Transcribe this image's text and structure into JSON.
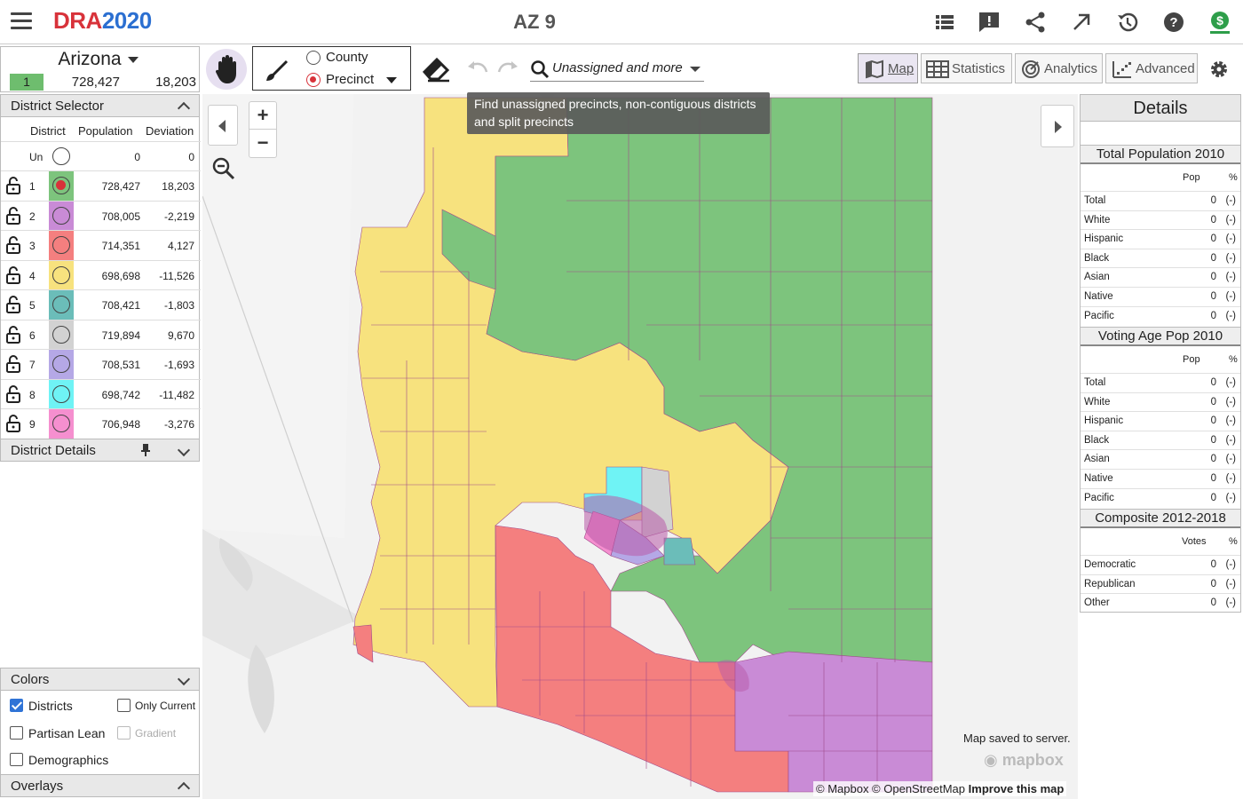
{
  "app": {
    "logo_part1": "DRA",
    "logo_part2": "2020",
    "title": "AZ 9"
  },
  "top_icons": [
    "list-icon",
    "feedback-icon",
    "share-icon",
    "open-external-icon",
    "history-icon",
    "help-icon",
    "donate-icon"
  ],
  "state": {
    "name": "Arizona",
    "badge": "1",
    "population": "728,427",
    "deviation": "18,203"
  },
  "paint": {
    "county_label": "County",
    "precinct_label": "Precinct"
  },
  "search": {
    "label": "Unassigned and more",
    "tooltip": "Find unassigned precincts, non-contiguous districts and split precincts"
  },
  "view_tabs": {
    "map": "Map",
    "statistics": "Statistics",
    "analytics": "Analytics",
    "advanced": "Advanced"
  },
  "district_selector": {
    "title": "District Selector",
    "headers": {
      "district": "District",
      "population": "Population",
      "deviation": "Deviation"
    },
    "unassigned": {
      "num": "Un",
      "population": "0",
      "deviation": "0"
    },
    "rows": [
      {
        "num": "1",
        "population": "728,427",
        "deviation": "18,203",
        "color": "#7dc47d"
      },
      {
        "num": "2",
        "population": "708,005",
        "deviation": "-2,219",
        "color": "#c98bd6"
      },
      {
        "num": "3",
        "population": "714,351",
        "deviation": "4,127",
        "color": "#f47f7f"
      },
      {
        "num": "4",
        "population": "698,698",
        "deviation": "-11,526",
        "color": "#f7e27e"
      },
      {
        "num": "5",
        "population": "708,421",
        "deviation": "-1,803",
        "color": "#6bbdb9"
      },
      {
        "num": "6",
        "population": "719,894",
        "deviation": "9,670",
        "color": "#d2d2d2"
      },
      {
        "num": "7",
        "population": "708,531",
        "deviation": "-1,693",
        "color": "#b5a8e6"
      },
      {
        "num": "8",
        "population": "698,742",
        "deviation": "-11,482",
        "color": "#6ff3f5"
      },
      {
        "num": "9",
        "population": "706,948",
        "deviation": "-3,276",
        "color": "#f58fcf"
      }
    ]
  },
  "district_details": {
    "title": "District Details"
  },
  "colors_panel": {
    "title": "Colors",
    "districts": "Districts",
    "only_current": "Only Current",
    "partisan_lean": "Partisan Lean",
    "gradient": "Gradient",
    "demographics": "Demographics"
  },
  "overlays": {
    "title": "Overlays"
  },
  "details": {
    "title": "Details",
    "total_pop": {
      "title": "Total Population 2010",
      "col_pop": "Pop",
      "col_pct": "%",
      "rows": [
        {
          "name": "Total",
          "value": "0",
          "pct": "(-)"
        },
        {
          "name": "White",
          "value": "0",
          "pct": "(-)"
        },
        {
          "name": "Hispanic",
          "value": "0",
          "pct": "(-)"
        },
        {
          "name": "Black",
          "value": "0",
          "pct": "(-)"
        },
        {
          "name": "Asian",
          "value": "0",
          "pct": "(-)"
        },
        {
          "name": "Native",
          "value": "0",
          "pct": "(-)"
        },
        {
          "name": "Pacific",
          "value": "0",
          "pct": "(-)"
        }
      ]
    },
    "vap": {
      "title": "Voting Age Pop 2010",
      "col_pop": "Pop",
      "col_pct": "%",
      "rows": [
        {
          "name": "Total",
          "value": "0",
          "pct": "(-)"
        },
        {
          "name": "White",
          "value": "0",
          "pct": "(-)"
        },
        {
          "name": "Hispanic",
          "value": "0",
          "pct": "(-)"
        },
        {
          "name": "Black",
          "value": "0",
          "pct": "(-)"
        },
        {
          "name": "Asian",
          "value": "0",
          "pct": "(-)"
        },
        {
          "name": "Native",
          "value": "0",
          "pct": "(-)"
        },
        {
          "name": "Pacific",
          "value": "0",
          "pct": "(-)"
        }
      ]
    },
    "composite": {
      "title": "Composite 2012-2018",
      "col_votes": "Votes",
      "col_pct": "%",
      "rows": [
        {
          "name": "Democratic",
          "value": "0",
          "pct": "(-)"
        },
        {
          "name": "Republican",
          "value": "0",
          "pct": "(-)"
        },
        {
          "name": "Other",
          "value": "0",
          "pct": "(-)"
        }
      ]
    }
  },
  "map": {
    "saved_status": "Map saved to server.",
    "mapbox_logo": "mapbox",
    "attribution": "© Mapbox © OpenStreetMap",
    "improve_link": "Improve this map"
  }
}
